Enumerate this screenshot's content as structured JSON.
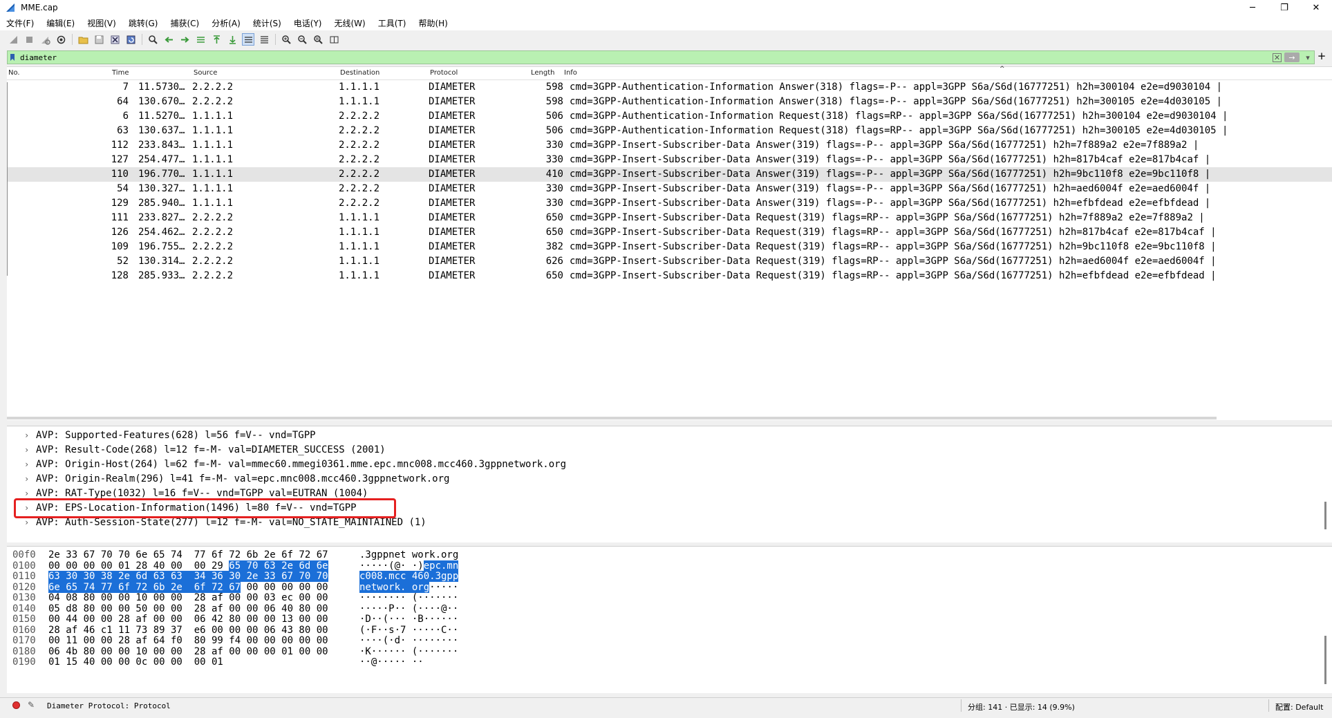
{
  "window": {
    "title": "MME.cap"
  },
  "menu": [
    "文件(F)",
    "编辑(E)",
    "视图(V)",
    "跳转(G)",
    "捕获(C)",
    "分析(A)",
    "统计(S)",
    "电话(Y)",
    "无线(W)",
    "工具(T)",
    "帮助(H)"
  ],
  "filter": {
    "value": "diameter"
  },
  "columns": {
    "no": "No.",
    "time": "Time",
    "source": "Source",
    "destination": "Destination",
    "protocol": "Protocol",
    "length": "Length",
    "info": "Info"
  },
  "packets": [
    {
      "no": "7",
      "time": "11.5730…",
      "src": "2.2.2.2",
      "dst": "1.1.1.1",
      "proto": "DIAMETER",
      "len": "598",
      "info": "cmd=3GPP-Authentication-Information Answer(318) flags=-P-- appl=3GPP S6a/S6d(16777251) h2h=300104 e2e=d9030104 |"
    },
    {
      "no": "64",
      "time": "130.670…",
      "src": "2.2.2.2",
      "dst": "1.1.1.1",
      "proto": "DIAMETER",
      "len": "598",
      "info": "cmd=3GPP-Authentication-Information Answer(318) flags=-P-- appl=3GPP S6a/S6d(16777251) h2h=300105 e2e=4d030105 |"
    },
    {
      "no": "6",
      "time": "11.5270…",
      "src": "1.1.1.1",
      "dst": "2.2.2.2",
      "proto": "DIAMETER",
      "len": "506",
      "info": "cmd=3GPP-Authentication-Information Request(318) flags=RP-- appl=3GPP S6a/S6d(16777251) h2h=300104 e2e=d9030104 |"
    },
    {
      "no": "63",
      "time": "130.637…",
      "src": "1.1.1.1",
      "dst": "2.2.2.2",
      "proto": "DIAMETER",
      "len": "506",
      "info": "cmd=3GPP-Authentication-Information Request(318) flags=RP-- appl=3GPP S6a/S6d(16777251) h2h=300105 e2e=4d030105 |"
    },
    {
      "no": "112",
      "time": "233.843…",
      "src": "1.1.1.1",
      "dst": "2.2.2.2",
      "proto": "DIAMETER",
      "len": "330",
      "info": "cmd=3GPP-Insert-Subscriber-Data Answer(319) flags=-P-- appl=3GPP S6a/S6d(16777251) h2h=7f889a2 e2e=7f889a2 |"
    },
    {
      "no": "127",
      "time": "254.477…",
      "src": "1.1.1.1",
      "dst": "2.2.2.2",
      "proto": "DIAMETER",
      "len": "330",
      "info": "cmd=3GPP-Insert-Subscriber-Data Answer(319) flags=-P-- appl=3GPP S6a/S6d(16777251) h2h=817b4caf e2e=817b4caf |"
    },
    {
      "no": "110",
      "time": "196.770…",
      "src": "1.1.1.1",
      "dst": "2.2.2.2",
      "proto": "DIAMETER",
      "len": "410",
      "info": "cmd=3GPP-Insert-Subscriber-Data Answer(319) flags=-P-- appl=3GPP S6a/S6d(16777251) h2h=9bc110f8 e2e=9bc110f8 |"
    },
    {
      "no": "54",
      "time": "130.327…",
      "src": "1.1.1.1",
      "dst": "2.2.2.2",
      "proto": "DIAMETER",
      "len": "330",
      "info": "cmd=3GPP-Insert-Subscriber-Data Answer(319) flags=-P-- appl=3GPP S6a/S6d(16777251) h2h=aed6004f e2e=aed6004f |"
    },
    {
      "no": "129",
      "time": "285.940…",
      "src": "1.1.1.1",
      "dst": "2.2.2.2",
      "proto": "DIAMETER",
      "len": "330",
      "info": "cmd=3GPP-Insert-Subscriber-Data Answer(319) flags=-P-- appl=3GPP S6a/S6d(16777251) h2h=efbfdead e2e=efbfdead |"
    },
    {
      "no": "111",
      "time": "233.827…",
      "src": "2.2.2.2",
      "dst": "1.1.1.1",
      "proto": "DIAMETER",
      "len": "650",
      "info": "cmd=3GPP-Insert-Subscriber-Data Request(319) flags=RP-- appl=3GPP S6a/S6d(16777251) h2h=7f889a2 e2e=7f889a2 |"
    },
    {
      "no": "126",
      "time": "254.462…",
      "src": "2.2.2.2",
      "dst": "1.1.1.1",
      "proto": "DIAMETER",
      "len": "650",
      "info": "cmd=3GPP-Insert-Subscriber-Data Request(319) flags=RP-- appl=3GPP S6a/S6d(16777251) h2h=817b4caf e2e=817b4caf |"
    },
    {
      "no": "109",
      "time": "196.755…",
      "src": "2.2.2.2",
      "dst": "1.1.1.1",
      "proto": "DIAMETER",
      "len": "382",
      "info": "cmd=3GPP-Insert-Subscriber-Data Request(319) flags=RP-- appl=3GPP S6a/S6d(16777251) h2h=9bc110f8 e2e=9bc110f8 |"
    },
    {
      "no": "52",
      "time": "130.314…",
      "src": "2.2.2.2",
      "dst": "1.1.1.1",
      "proto": "DIAMETER",
      "len": "626",
      "info": "cmd=3GPP-Insert-Subscriber-Data Request(319) flags=RP-- appl=3GPP S6a/S6d(16777251) h2h=aed6004f e2e=aed6004f |"
    },
    {
      "no": "128",
      "time": "285.933…",
      "src": "2.2.2.2",
      "dst": "1.1.1.1",
      "proto": "DIAMETER",
      "len": "650",
      "info": "cmd=3GPP-Insert-Subscriber-Data Request(319) flags=RP-- appl=3GPP S6a/S6d(16777251) h2h=efbfdead e2e=efbfdead |"
    }
  ],
  "selected_packet_index": 6,
  "details": [
    "AVP: Supported-Features(628) l=56 f=V-- vnd=TGPP",
    "AVP: Result-Code(268) l=12 f=-M- val=DIAMETER_SUCCESS (2001)",
    "AVP: Origin-Host(264) l=62 f=-M- val=mmec60.mmegi0361.mme.epc.mnc008.mcc460.3gppnetwork.org",
    "AVP: Origin-Realm(296) l=41 f=-M- val=epc.mnc008.mcc460.3gppnetwork.org",
    "AVP: RAT-Type(1032) l=16 f=V-- vnd=TGPP val=EUTRAN (1004)",
    "AVP: EPS-Location-Information(1496) l=80 f=V-- vnd=TGPP",
    "AVP: Auth-Session-State(277) l=12 f=-M- val=NO_STATE_MAINTAINED (1)"
  ],
  "highlighted_detail_index": 5,
  "hex": [
    {
      "off": "00f0",
      "bytes": "2e 33 67 70 70 6e 65 74  77 6f 72 6b 2e 6f 72 67",
      "ascii": ".3gppnet work.org",
      "hl_from": -1
    },
    {
      "off": "0100",
      "bytes": "00 00 00 00 01 28 40 00  00 29 65 70 63 2e 6d 6e",
      "ascii": "·····(@· ·)epc.mn",
      "hl_from": 10
    },
    {
      "off": "0110",
      "bytes": "63 30 30 38 2e 6d 63 63  34 36 30 2e 33 67 70 70",
      "ascii": "c008.mcc 460.3gpp",
      "hl_from": 0
    },
    {
      "off": "0120",
      "bytes": "6e 65 74 77 6f 72 6b 2e  6f 72 67 00 00 00 00 00",
      "ascii": "network. org·····",
      "hl_to": 11
    },
    {
      "off": "0130",
      "bytes": "04 08 80 00 00 10 00 00  28 af 00 00 03 ec 00 00",
      "ascii": "········ (·······",
      "hl_from": -1
    },
    {
      "off": "0140",
      "bytes": "05 d8 80 00 00 50 00 00  28 af 00 00 06 40 80 00",
      "ascii": "·····P·· (····@··",
      "hl_from": -1
    },
    {
      "off": "0150",
      "bytes": "00 44 00 00 28 af 00 00  06 42 80 00 00 13 00 00",
      "ascii": "·D··(··· ·B······",
      "hl_from": -1
    },
    {
      "off": "0160",
      "bytes": "28 af 46 c1 11 73 89 37  e6 00 00 00 06 43 80 00",
      "ascii": "(·F··s·7 ·····C··",
      "hl_from": -1
    },
    {
      "off": "0170",
      "bytes": "00 11 00 00 28 af 64 f0  80 99 f4 00 00 00 00 00",
      "ascii": "····(·d· ········",
      "hl_from": -1
    },
    {
      "off": "0180",
      "bytes": "06 4b 80 00 00 10 00 00  28 af 00 00 00 01 00 00",
      "ascii": "·K······ (·······",
      "hl_from": -1
    },
    {
      "off": "0190",
      "bytes": "01 15 40 00 00 0c 00 00  00 01",
      "ascii": "··@····· ··",
      "hl_from": -1
    }
  ],
  "status": {
    "text": "Diameter Protocol: Protocol",
    "packets": "分组: 141 · 已显示: 14 (9.9%)",
    "profile": "配置: Default"
  },
  "colors": {
    "filter_bg": "#b9f0b2",
    "selection": "#1b6fd8",
    "highlight_box": "#e52020"
  }
}
